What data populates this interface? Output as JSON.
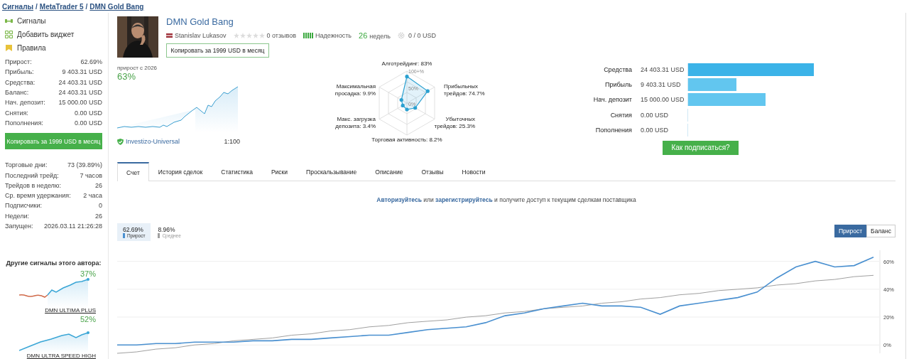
{
  "breadcrumbs": [
    "Сигналы",
    "MetaTrader 5",
    "DMN Gold Bang"
  ],
  "breadcrumb_separator": "/",
  "sidebar": {
    "menu": [
      {
        "label": "Сигналы",
        "kind": "signals"
      },
      {
        "label": "Добавить виджет",
        "kind": "widget"
      },
      {
        "label": "Правила",
        "kind": "rules"
      }
    ],
    "stats": [
      {
        "label": "Прирост:",
        "value": "62.69%"
      },
      {
        "label": "Прибыль:",
        "value": "9 403.31 USD"
      },
      {
        "label": "Средства:",
        "value": "24 403.31 USD"
      },
      {
        "label": "Баланс:",
        "value": "24 403.31 USD"
      },
      {
        "label": "Нач. депозит:",
        "value": "15 000.00 USD"
      },
      {
        "label": "Снятия:",
        "value": "0.00 USD"
      },
      {
        "label": "Пополнения:",
        "value": "0.00 USD"
      }
    ],
    "copy_button": "Копировать за 1999 USD в месяц",
    "stats2": [
      {
        "label": "Торговые дни:",
        "value": "73 (39.89%)"
      },
      {
        "label": "Последний трейд:",
        "value": "7 часов"
      },
      {
        "label": "Трейдов в неделю:",
        "value": "26"
      },
      {
        "label": "Ср. время удержания:",
        "value": "2 часа"
      },
      {
        "label": "Подписчики:",
        "value": "0"
      },
      {
        "label": "Недели:",
        "value": "26"
      },
      {
        "label": "Запущен:",
        "value": "2026.03.11 21:26:28"
      }
    ],
    "other_title": "Другие сигналы этого автора:",
    "other_signals": [
      {
        "growth": "37%",
        "name": "DMN ULTIMA PLUS",
        "kind": "mixed"
      },
      {
        "growth": "52%",
        "name": "DMN ULTRA SPEED HIGH",
        "kind": "rising"
      }
    ]
  },
  "header": {
    "title": "DMN Gold Bang",
    "author": "Stanislav Lukasov",
    "stars": 0,
    "reviews": "0 отзывов",
    "reliability": {
      "label": "Надежность",
      "level": 1
    },
    "weeks_value": "26",
    "weeks_label": "недель",
    "subscribers_funds": "0 / 0 USD",
    "copy_button": "Копировать за 1999 USD в месяц"
  },
  "growth": {
    "label": "прирост с 2026",
    "value": "63%",
    "broker": "Investizo-Universal",
    "leverage": "1:100"
  },
  "radar": {
    "ticks": [
      "100+%",
      "50%",
      "0%"
    ],
    "axes": [
      {
        "label": "Алготрейдинг: 83%",
        "kind": "top"
      },
      {
        "label": "Максимальная просадка: 9.9%",
        "kind": "upperleft"
      },
      {
        "label": "Прибыльных трейдов: 74.7%",
        "kind": "upperright"
      },
      {
        "label": "Макс. загрузка депозита: 3.4%",
        "kind": "lowerleft"
      },
      {
        "label": "Убыточных трейдов: 25.3%",
        "kind": "lowerright"
      },
      {
        "label": "Торговая активность: 8.2%",
        "kind": "bottom"
      }
    ]
  },
  "balance_bars": [
    {
      "label": "Средства",
      "value": "24 403.31 USD",
      "level": 1
    },
    {
      "label": "Прибыль",
      "value": "9 403.31 USD",
      "level": 0.385
    },
    {
      "label": "Нач. депозит",
      "value": "15 000.00 USD",
      "level": 0.615
    },
    {
      "label": "Снятия",
      "value": "0.00 USD",
      "level": 0
    },
    {
      "label": "Пополнения",
      "value": "0.00 USD",
      "level": 0
    }
  ],
  "subscribe_button": "Как подписаться?",
  "tabs": [
    {
      "label": "Счет",
      "selected": true
    },
    {
      "label": "История сделок",
      "selected": false
    },
    {
      "label": "Статистика",
      "selected": false
    },
    {
      "label": "Риски",
      "selected": false
    },
    {
      "label": "Проскальзывание",
      "selected": false
    },
    {
      "label": "Описание",
      "selected": false
    },
    {
      "label": "Отзывы",
      "selected": false
    },
    {
      "label": "Новости",
      "selected": false
    }
  ],
  "notice": [
    {
      "text": "Авторизуйтесь",
      "kind": "link"
    },
    {
      "text": " или ",
      "kind": "text"
    },
    {
      "text": "зарегистрируйтесь",
      "kind": "link"
    },
    {
      "text": " и получите доступ к текущим сделкам поставщика",
      "kind": "text"
    }
  ],
  "legend": [
    {
      "value": "62.69%",
      "selected": true
    },
    {
      "value": "8.96%",
      "selected": false
    }
  ],
  "chart_toggle": [
    {
      "label": "Прирост",
      "selected": true
    },
    {
      "label": "Баланс",
      "selected": false
    }
  ],
  "chart_data": {
    "type": "line",
    "grid": true,
    "ylim": [
      -6,
      68
    ],
    "yticks": [
      {
        "value": 0,
        "label": "0%"
      },
      {
        "value": 20,
        "label": "20%"
      },
      {
        "value": 40,
        "label": "40%"
      },
      {
        "value": 60,
        "label": "60%"
      }
    ],
    "series": [
      {
        "name": "Прирост",
        "color": "#4a90d0",
        "values": [
          0,
          0,
          1,
          1,
          2,
          2,
          2,
          3,
          3,
          4,
          4,
          5,
          6,
          7,
          7,
          9,
          11,
          12,
          13,
          16,
          21,
          23,
          26,
          28,
          30,
          28,
          28,
          27,
          22,
          28,
          30,
          32,
          34,
          38,
          48,
          56,
          60,
          56,
          57,
          63
        ]
      },
      {
        "name": "Среднее",
        "color": "#a0a0a0",
        "values": [
          -6,
          -5,
          -3,
          -2,
          0,
          1,
          3,
          4,
          5,
          7,
          8,
          10,
          11,
          13,
          14,
          16,
          17,
          18,
          20,
          21,
          23,
          24,
          26,
          27,
          28,
          30,
          31,
          33,
          34,
          36,
          37,
          39,
          40,
          41,
          43,
          44,
          46,
          47,
          49,
          50
        ]
      }
    ]
  }
}
